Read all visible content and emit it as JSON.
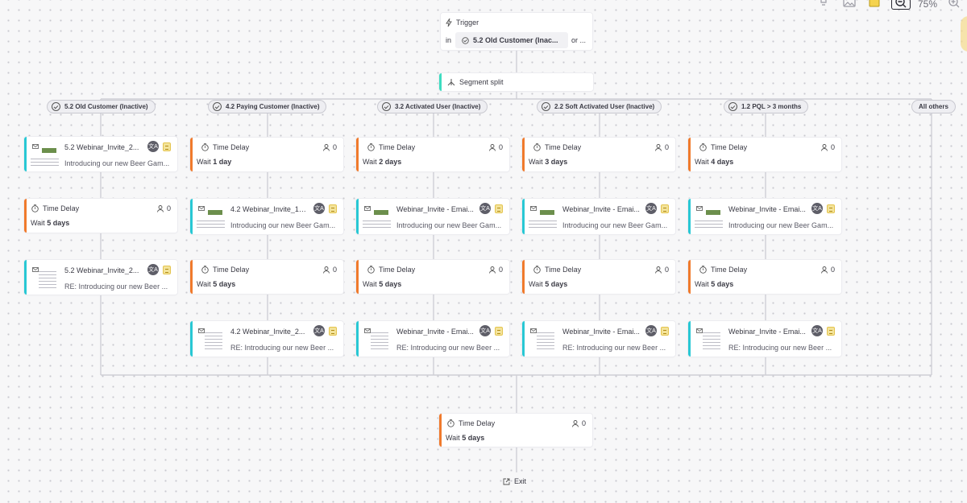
{
  "toolbar": {
    "zoom": "75%"
  },
  "trigger": {
    "title": "Trigger",
    "in": "in",
    "segment": "5.2 Old Customer (Inac...",
    "or": "or ..."
  },
  "split": {
    "label": "Segment split"
  },
  "branches": [
    {
      "label": "5.2 Old Customer (Inactive)"
    },
    {
      "label": "4.2 Paying Customer (Inactive)"
    },
    {
      "label": "3.2 Activated User (Inactive)"
    },
    {
      "label": "2.2 Soft Activated User (Inactive)"
    },
    {
      "label": "1.2 PQL > 3 months"
    },
    {
      "label": "All others"
    }
  ],
  "delay_title": "Time Delay",
  "wait_word": "Wait",
  "nodes": {
    "c1_email1": {
      "name": "5.2 Webinar_Invite_2...",
      "subject": "Introducing our new Beer Gam..."
    },
    "c1_delay1": {
      "value": "5 days",
      "count": "0"
    },
    "c1_email2": {
      "name": "5.2 Webinar_Invite_2...",
      "subject": "RE: Introducing our new Beer ..."
    },
    "c2_delay1": {
      "value": "1 day",
      "count": "0"
    },
    "c2_email1": {
      "name": "4.2 Webinar_Invite_1_...",
      "subject": "Introducing our new Beer Gam..."
    },
    "c2_delay2": {
      "value": "5 days",
      "count": "0"
    },
    "c2_email2": {
      "name": "4.2 Webinar_Invite_2...",
      "subject": "RE: Introducing our new Beer ..."
    },
    "c3_delay1": {
      "value": "2 days",
      "count": "0"
    },
    "c3_email1": {
      "name": "Webinar_Invite - Emai...",
      "subject": "Introducing our new Beer Gam..."
    },
    "c3_delay2": {
      "value": "5 days",
      "count": "0"
    },
    "c3_email2": {
      "name": "Webinar_Invite - Emai...",
      "subject": "RE: Introducing our new Beer ..."
    },
    "c4_delay1": {
      "value": "3 days",
      "count": "0"
    },
    "c4_email1": {
      "name": "Webinar_Invite - Emai...",
      "subject": "Introducing our new Beer Gam..."
    },
    "c4_delay2": {
      "value": "5 days",
      "count": "0"
    },
    "c4_email2": {
      "name": "Webinar_Invite - Emai...",
      "subject": "RE: Introducing our new Beer ..."
    },
    "c5_delay1": {
      "value": "4 days",
      "count": "0"
    },
    "c5_email1": {
      "name": "Webinar_Invite - Emai...",
      "subject": "Introducing our new Beer Gam..."
    },
    "c5_delay2": {
      "value": "5 days",
      "count": "0"
    },
    "c5_email2": {
      "name": "Webinar_Invite - Emai...",
      "subject": "RE: Introducing our new Beer ..."
    },
    "final_delay": {
      "value": "5 days",
      "count": "0"
    }
  },
  "exit": {
    "label": "Exit"
  },
  "colors": {
    "delay_accent": "#f07a2c",
    "email_accent": "#28c8d4",
    "trigger_accent": "#3ddcc0"
  },
  "icons": [
    "bulb-icon",
    "image-icon",
    "sticky-note-icon",
    "zoom-out-icon",
    "zoom-in-icon",
    "clock-icon",
    "person-icon",
    "email-icon",
    "translate-icon",
    "document-icon",
    "segment-icon",
    "split-icon",
    "lightning-icon",
    "exit-icon"
  ]
}
